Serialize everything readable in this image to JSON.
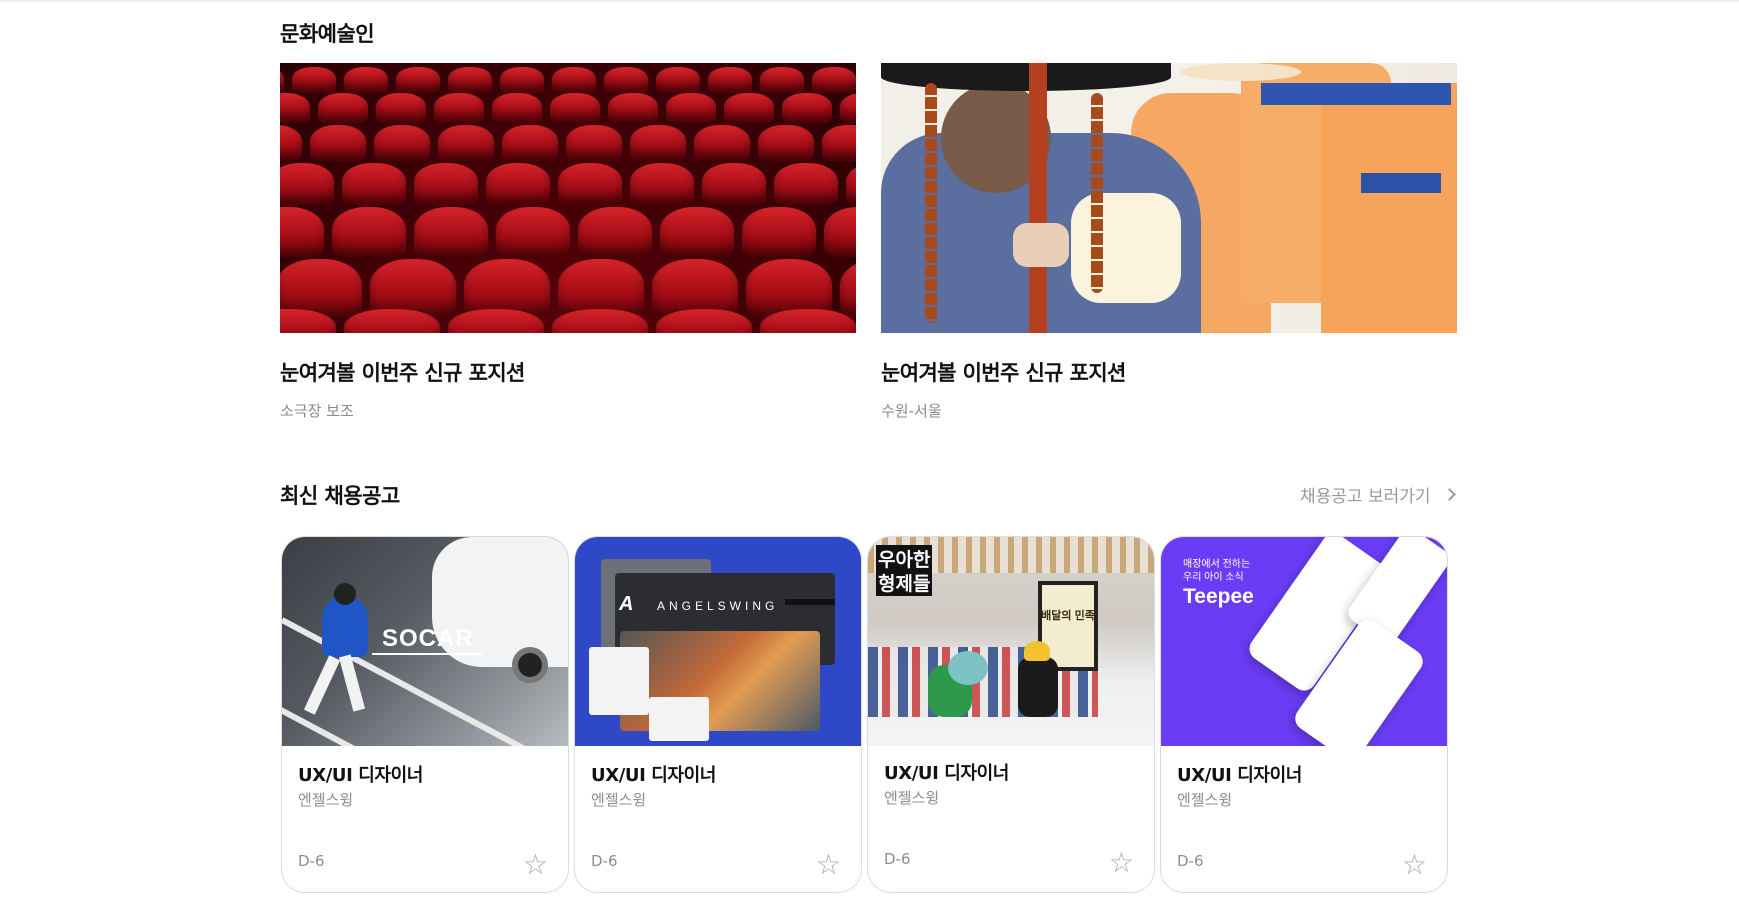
{
  "sections": {
    "culture": {
      "title": "문화예술인",
      "features": [
        {
          "title": "눈여겨볼 이번주 신규 포지션",
          "subtitle": "소극장 보조",
          "image": "theater-seats-image"
        },
        {
          "title": "눈여겨볼 이번주 신규 포지션",
          "subtitle": "수원-서울",
          "image": "traditional-costume-image"
        }
      ]
    },
    "recent": {
      "title": "최신 채용공고",
      "more_label": "채용공고 보러가기",
      "cards": [
        {
          "title": "UX/UI 디자이너",
          "company": "엔젤스윙",
          "dday": "D-6",
          "brand": "SOCAR"
        },
        {
          "title": "UX/UI 디자이너",
          "company": "엔젤스윙",
          "dday": "D-6",
          "brand": "ANGELSWING"
        },
        {
          "title": "UX/UI 디자이너",
          "company": "엔젤스윙",
          "dday": "D-6",
          "brand": "우아한 형제들",
          "brand_line1": "우아한",
          "brand_line2": "형제들",
          "poster_text": "배달의 민족"
        },
        {
          "title": "UX/UI 디자이너",
          "company": "엔젤스윙",
          "dday": "D-6",
          "brand": "Teepee",
          "tagline_line1": "매장에서 전하는",
          "tagline_line2": "우리 아이 소식"
        }
      ]
    }
  },
  "icons": {
    "star": "star-outline-icon",
    "chevron": "chevron-right-icon"
  },
  "colors": {
    "teepee_purple": "#6b3cf5",
    "angelswing_blue": "#2f48c7",
    "theater_red": "#b3121c"
  }
}
